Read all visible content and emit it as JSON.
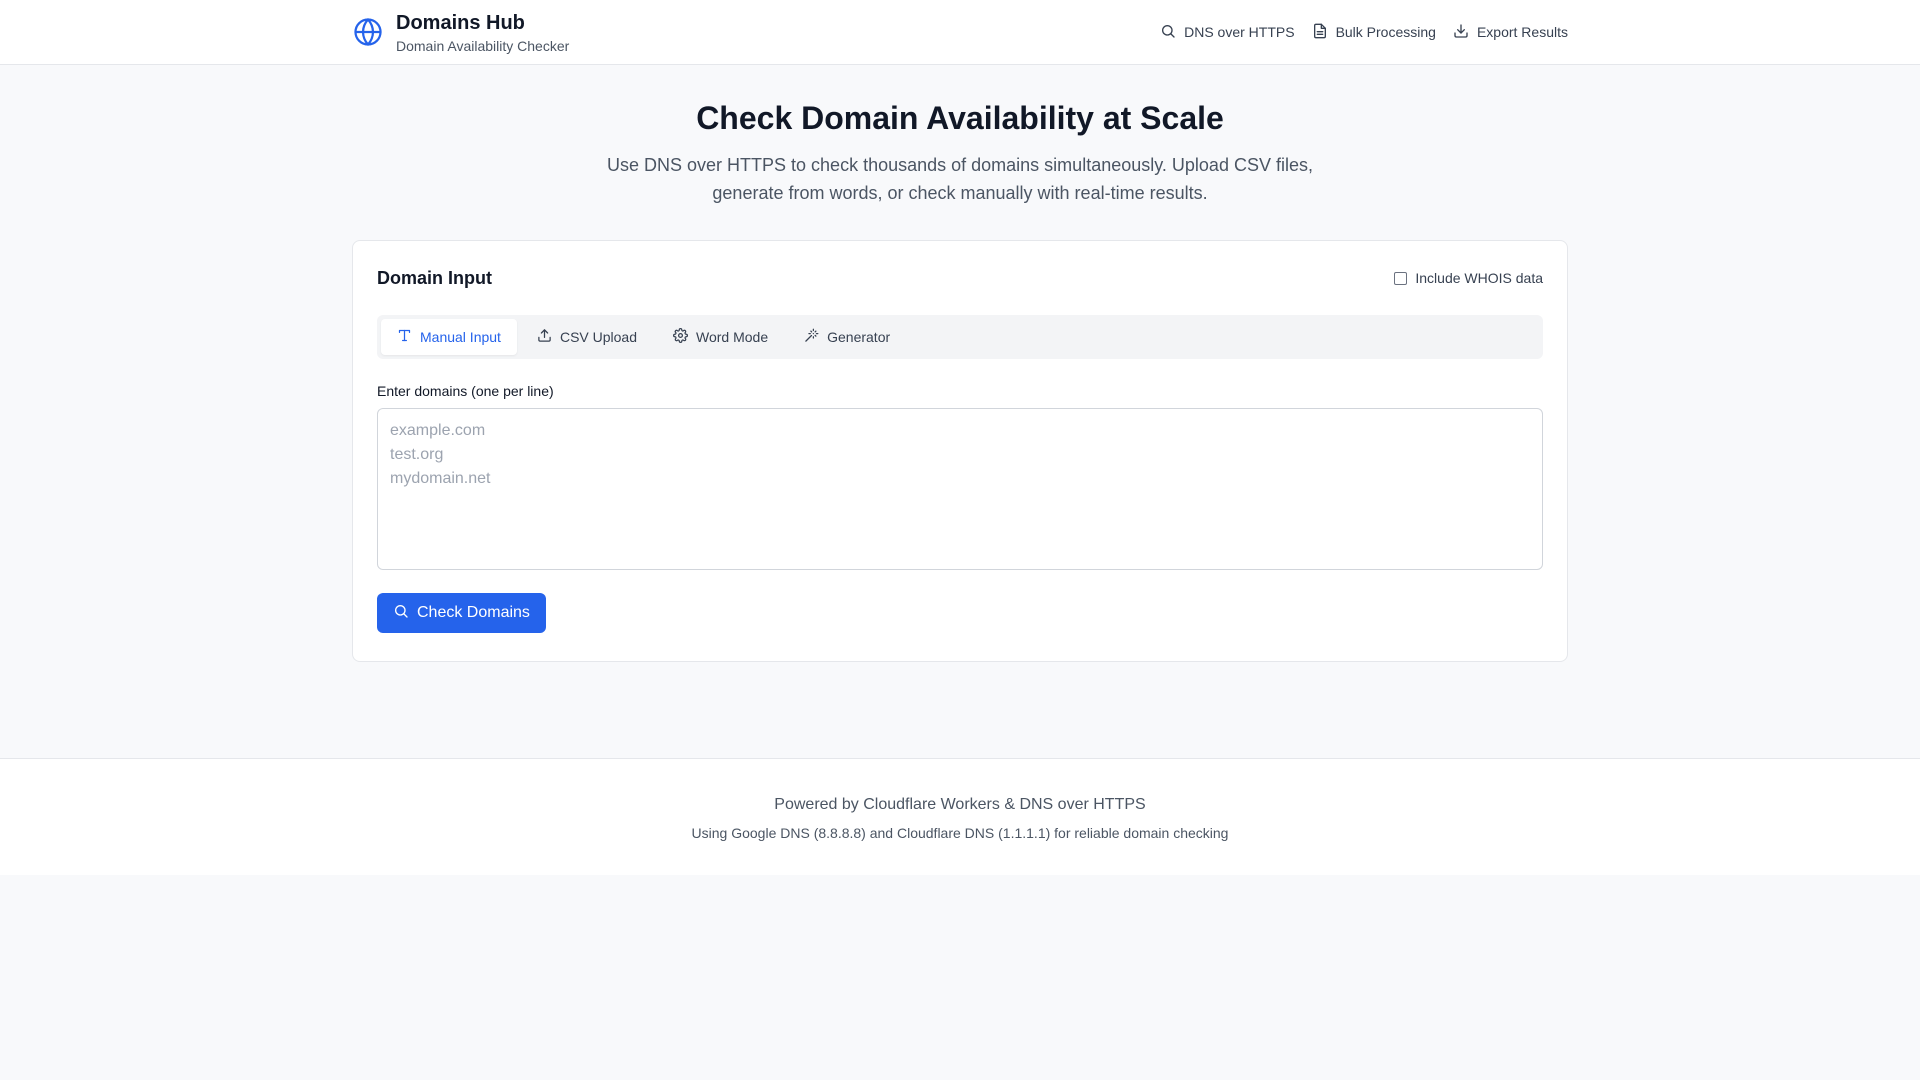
{
  "header": {
    "logo_icon": "globe-icon",
    "title": "Domains Hub",
    "subtitle": "Domain Availability Checker",
    "nav": [
      {
        "label": "DNS over HTTPS",
        "icon": "search-icon"
      },
      {
        "label": "Bulk Processing",
        "icon": "document-icon"
      },
      {
        "label": "Export Results",
        "icon": "download-icon"
      }
    ]
  },
  "hero": {
    "title": "Check Domain Availability at Scale",
    "description": "Use DNS over HTTPS to check thousands of domains simultaneously. Upload CSV files, generate from words, or check manually with real-time results."
  },
  "card": {
    "title": "Domain Input",
    "whois_label": "Include WHOIS data",
    "whois_checked": false,
    "tabs": [
      {
        "label": "Manual Input",
        "icon": "text-icon",
        "active": true
      },
      {
        "label": "CSV Upload",
        "icon": "upload-icon",
        "active": false
      },
      {
        "label": "Word Mode",
        "icon": "gear-icon",
        "active": false
      },
      {
        "label": "Generator",
        "icon": "magic-wand-icon",
        "active": false
      }
    ],
    "field_label": "Enter domains (one per line)",
    "textarea_value": "",
    "textarea_placeholder": "example.com\ntest.org\nmydomain.net",
    "submit_label": "Check Domains"
  },
  "footer": {
    "main": "Powered by Cloudflare Workers & DNS over HTTPS",
    "sub": "Using Google DNS (8.8.8.8) and Cloudflare DNS (1.1.1.1) for reliable domain checking"
  },
  "colors": {
    "accent": "#2563eb",
    "background": "#f8f9fb",
    "text": "#111827",
    "muted": "#4b5563"
  }
}
